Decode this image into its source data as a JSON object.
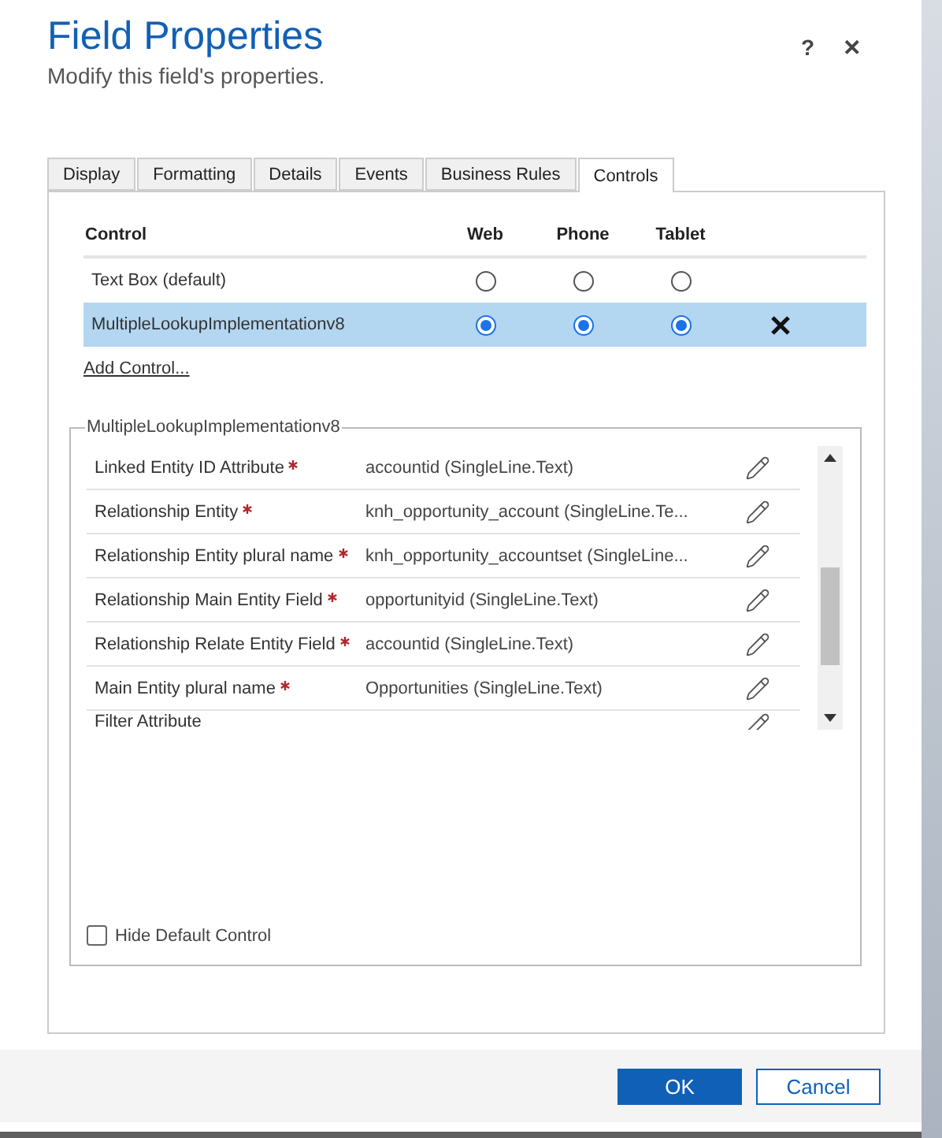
{
  "dialog": {
    "title": "Field Properties",
    "subtitle": "Modify this field's properties.",
    "help_button": "?",
    "close_button": "✕"
  },
  "tabs": [
    {
      "label": "Display",
      "selected": false
    },
    {
      "label": "Formatting",
      "selected": false
    },
    {
      "label": "Details",
      "selected": false
    },
    {
      "label": "Events",
      "selected": false
    },
    {
      "label": "Business Rules",
      "selected": false
    },
    {
      "label": "Controls",
      "selected": true
    }
  ],
  "controls_table": {
    "columns": [
      "Control",
      "Web",
      "Phone",
      "Tablet"
    ],
    "rows": [
      {
        "name": "Text Box (default)",
        "selected": false,
        "removable": false,
        "options": [
          {
            "selected": false
          },
          {
            "selected": false
          },
          {
            "selected": false
          }
        ]
      },
      {
        "name": "MultipleLookupImplementationv8",
        "selected": true,
        "removable": true,
        "options": [
          {
            "selected": true
          },
          {
            "selected": true
          },
          {
            "selected": true
          }
        ]
      }
    ]
  },
  "add_control_link": "Add Control...",
  "properties": {
    "legend": "MultipleLookupImplementationv8",
    "rows": [
      {
        "label": "Linked Entity ID Attribute",
        "required": true,
        "value": "accountid (SingleLine.Text)"
      },
      {
        "label": "Relationship Entity",
        "required": true,
        "value": "knh_opportunity_account (SingleLine.Te..."
      },
      {
        "label": "Relationship Entity plural name",
        "required": true,
        "value": "knh_opportunity_accountset (SingleLine..."
      },
      {
        "label": "Relationship Main Entity Field",
        "required": true,
        "value": "opportunityid (SingleLine.Text)"
      },
      {
        "label": "Relationship Relate Entity Field",
        "required": true,
        "value": "accountid (SingleLine.Text)"
      },
      {
        "label": "Main Entity plural name",
        "required": true,
        "value": "Opportunities (SingleLine.Text)"
      },
      {
        "label": "Filter Attribute",
        "required": false
      }
    ]
  },
  "hide_default_control": {
    "label": "Hide Default Control",
    "checked": false
  },
  "buttons": [
    {
      "label": "OK",
      "kind": "primary"
    },
    {
      "label": "Cancel",
      "kind": "secondary"
    }
  ]
}
